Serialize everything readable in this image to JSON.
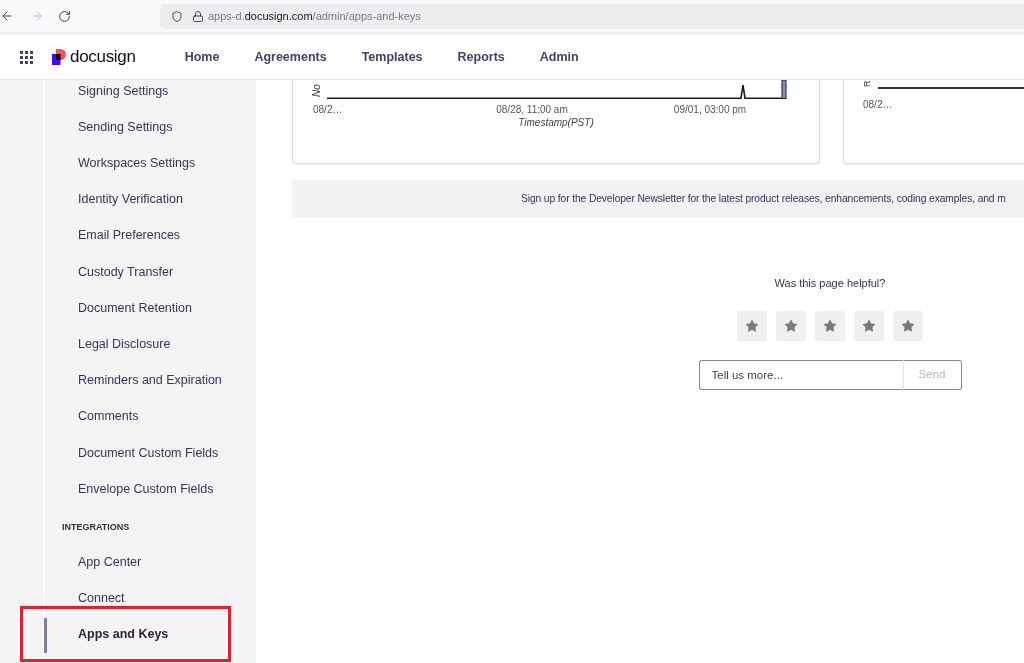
{
  "browser": {
    "url": {
      "subdomain": "apps-d.",
      "domain": "docusign.com",
      "path": "/admin/apps-and-keys"
    }
  },
  "header": {
    "logo": "docusign",
    "nav": [
      {
        "label": "Home"
      },
      {
        "label": "Agreements"
      },
      {
        "label": "Templates"
      },
      {
        "label": "Reports"
      },
      {
        "label": "Admin"
      }
    ]
  },
  "sidebar": {
    "groups": [
      {
        "items": [
          {
            "label": "Signing Settings",
            "selected": false,
            "highlighted": false
          },
          {
            "label": "Sending Settings",
            "selected": false,
            "highlighted": false
          },
          {
            "label": "Workspaces Settings",
            "selected": false,
            "highlighted": false
          },
          {
            "label": "Identity Verification",
            "selected": false,
            "highlighted": false
          },
          {
            "label": "Email Preferences",
            "selected": false,
            "highlighted": false
          },
          {
            "label": "Custody Transfer",
            "selected": false,
            "highlighted": false
          },
          {
            "label": "Document Retention",
            "selected": false,
            "highlighted": false
          },
          {
            "label": "Legal Disclosure",
            "selected": false,
            "highlighted": false
          },
          {
            "label": "Reminders and Expiration",
            "selected": false,
            "highlighted": false
          },
          {
            "label": "Comments",
            "selected": false,
            "highlighted": false
          },
          {
            "label": "Document Custom Fields",
            "selected": false,
            "highlighted": false
          },
          {
            "label": "Envelope Custom Fields",
            "selected": false,
            "highlighted": false
          }
        ]
      },
      {
        "heading": "INTEGRATIONS",
        "items": [
          {
            "label": "App Center",
            "selected": false,
            "highlighted": false
          },
          {
            "label": "Connect",
            "selected": false,
            "highlighted": false
          },
          {
            "label": "Apps and Keys",
            "selected": true,
            "highlighted": true
          }
        ]
      }
    ]
  },
  "charts": [
    {
      "y_label": "No",
      "x_ticks": [
        "08/2…",
        "08/28, 11:00 am",
        "09/01, 03:00 pm"
      ],
      "x_title": "Timestamp(PST)"
    },
    {
      "y_label": "R",
      "x_ticks": [
        "08/2…"
      ]
    }
  ],
  "newsletter": {
    "text": "Sign up for the Developer Newsletter for the latest product releases, enhancements, coding examples, and m"
  },
  "feedback": {
    "question": "Was this page helpful?",
    "comment": {
      "placeholder": "Tell us more...",
      "button": "Send",
      "disabled": true
    }
  }
}
